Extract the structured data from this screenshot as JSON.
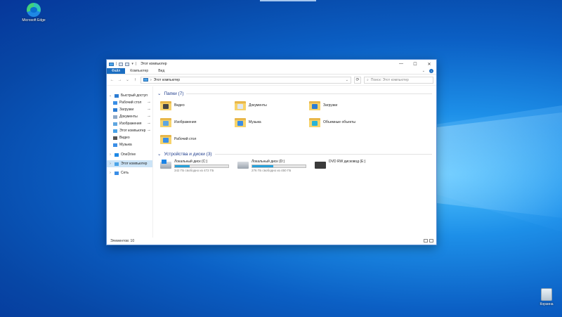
{
  "desktop": {
    "icons": [
      {
        "label": "Microsoft Edge"
      },
      {
        "label": "Корзина"
      }
    ]
  },
  "window": {
    "title": "Этот компьютер",
    "quick_access_toolbar": [
      "|",
      "▾"
    ],
    "controls": {
      "minimize": "—",
      "maximize": "☐",
      "close": "✕"
    },
    "ribbon_tabs": [
      "Файл",
      "Компьютер",
      "Вид"
    ],
    "ribbon_right": {
      "expand": "⌄",
      "help": "?"
    },
    "nav_buttons": {
      "back": "←",
      "forward": "→",
      "recent": "⌄",
      "up": "↑"
    },
    "address": {
      "path": "Этот компьютер",
      "separator": "›"
    },
    "search": {
      "placeholder": "Поиск: Этот компьютер"
    },
    "sidebar": {
      "items": [
        {
          "label": "Быстрый доступ",
          "expanded": true,
          "pinned": false,
          "icon": "star-icon",
          "color": "#2b7cd3"
        },
        {
          "label": "Рабочий стол",
          "pinned": true,
          "icon": "desktop-icon",
          "color": "#3a8ee6"
        },
        {
          "label": "Загрузки",
          "pinned": true,
          "icon": "download-icon",
          "color": "#2b7cd3"
        },
        {
          "label": "Документы",
          "pinned": true,
          "icon": "documents-icon",
          "color": "#8ea9c8"
        },
        {
          "label": "Изображения",
          "pinned": true,
          "icon": "pictures-icon",
          "color": "#5fa6e0"
        },
        {
          "label": "Этот компьютер",
          "pinned": true,
          "icon": "computer-icon",
          "color": "#4aa3e8"
        },
        {
          "label": "Видео",
          "pinned": false,
          "icon": "video-icon",
          "color": "#555555"
        },
        {
          "label": "Музыка",
          "pinned": false,
          "icon": "music-icon",
          "color": "#3a8ee6"
        },
        {
          "label": "OneDrive",
          "pinned": false,
          "icon": "onedrive-icon",
          "color": "#1e88e5"
        },
        {
          "label": "Этот компьютер",
          "pinned": false,
          "selected": true,
          "icon": "computer-icon",
          "color": "#4aa3e8"
        },
        {
          "label": "Сеть",
          "pinned": false,
          "icon": "network-icon",
          "color": "#3a8ee6"
        }
      ]
    },
    "folders_section": {
      "title": "Папки (7)"
    },
    "folders": [
      {
        "label": "Видео",
        "icon": "video-folder-icon",
        "badge_color": "#444444"
      },
      {
        "label": "Документы",
        "icon": "documents-folder-icon",
        "badge_color": "#dfe7f1"
      },
      {
        "label": "Загрузки",
        "icon": "downloads-folder-icon",
        "badge_color": "#2b7cd3"
      },
      {
        "label": "Изображения",
        "icon": "pictures-folder-icon",
        "badge_color": "#5fa6e0"
      },
      {
        "label": "Музыка",
        "icon": "music-folder-icon",
        "badge_color": "#3a8ee6"
      },
      {
        "label": "Объемные объекты",
        "icon": "3d-objects-folder-icon",
        "badge_color": "#27b4d8"
      },
      {
        "label": "Рабочий стол",
        "icon": "desktop-folder-icon",
        "badge_color": "#3a8ee6"
      }
    ],
    "drives_section": {
      "title": "Устройства и диски (3)"
    },
    "drives": [
      {
        "label": "Локальный диск (C:)",
        "free_text": "342 ГБ свободно из 472 ГБ",
        "used_fraction": 0.28,
        "icon": "system-drive-icon"
      },
      {
        "label": "Локальный диск (D:)",
        "free_text": "276 ГБ свободно из 450 ГБ",
        "used_fraction": 0.39,
        "icon": "local-drive-icon"
      },
      {
        "label": "DVD RW дисковод (E:)",
        "free_text": "",
        "used_fraction": null,
        "icon": "dvd-drive-icon"
      }
    ],
    "status": {
      "items_count": "Элементов: 10"
    }
  }
}
